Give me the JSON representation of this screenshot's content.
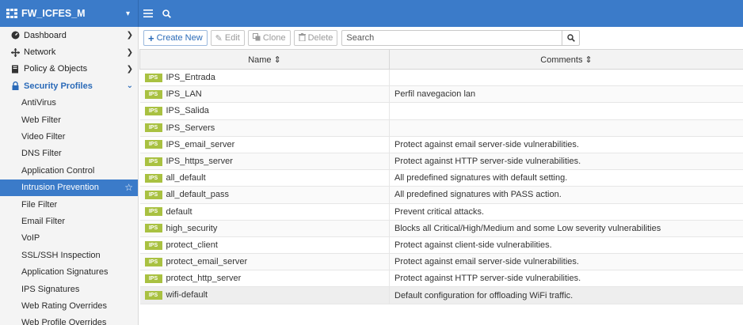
{
  "app": {
    "device_name": "FW_ICFES_M"
  },
  "colors": {
    "topbar": "#3b7bc9",
    "active": "#3b7bc9",
    "badge": "#a9c141",
    "section": "#2a6ab8"
  },
  "sidebar": {
    "top_items": [
      {
        "label": "Dashboard",
        "icon": "dashboard-icon"
      },
      {
        "label": "Network",
        "icon": "network-icon"
      },
      {
        "label": "Policy & Objects",
        "icon": "policy-icon"
      }
    ],
    "section": {
      "label": "Security Profiles",
      "icon": "lock-icon"
    },
    "sub_items": [
      "AntiVirus",
      "Web Filter",
      "Video Filter",
      "DNS Filter",
      "Application Control",
      "Intrusion Prevention",
      "File Filter",
      "Email Filter",
      "VoIP",
      "SSL/SSH Inspection",
      "Application Signatures",
      "IPS Signatures",
      "Web Rating Overrides",
      "Web Profile Overrides"
    ],
    "active_item": "Intrusion Prevention"
  },
  "toolbar": {
    "create_label": "Create New",
    "edit_label": "Edit",
    "clone_label": "Clone",
    "delete_label": "Delete",
    "search_placeholder": "Search"
  },
  "table": {
    "headers": {
      "name": "Name ⇕",
      "comments": "Comments ⇕"
    },
    "badge_label": "IPS",
    "rows": [
      {
        "name": "IPS_Entrada",
        "comment": ""
      },
      {
        "name": "IPS_LAN",
        "comment": "Perfil navegacion lan"
      },
      {
        "name": "IPS_Salida",
        "comment": ""
      },
      {
        "name": "IPS_Servers",
        "comment": ""
      },
      {
        "name": "IPS_email_server",
        "comment": "Protect against email server-side vulnerabilities."
      },
      {
        "name": "IPS_https_server",
        "comment": "Protect against HTTP server-side vulnerabilities."
      },
      {
        "name": "all_default",
        "comment": "All predefined signatures with default setting."
      },
      {
        "name": "all_default_pass",
        "comment": "All predefined signatures with PASS action."
      },
      {
        "name": "default",
        "comment": "Prevent critical attacks."
      },
      {
        "name": "high_security",
        "comment": "Blocks all Critical/High/Medium and some Low severity vulnerabilities"
      },
      {
        "name": "protect_client",
        "comment": "Protect against client-side vulnerabilities."
      },
      {
        "name": "protect_email_server",
        "comment": "Protect against email server-side vulnerabilities."
      },
      {
        "name": "protect_http_server",
        "comment": "Protect against HTTP server-side vulnerabilities."
      },
      {
        "name": "wifi-default",
        "comment": "Default configuration for offloading WiFi traffic."
      }
    ]
  }
}
